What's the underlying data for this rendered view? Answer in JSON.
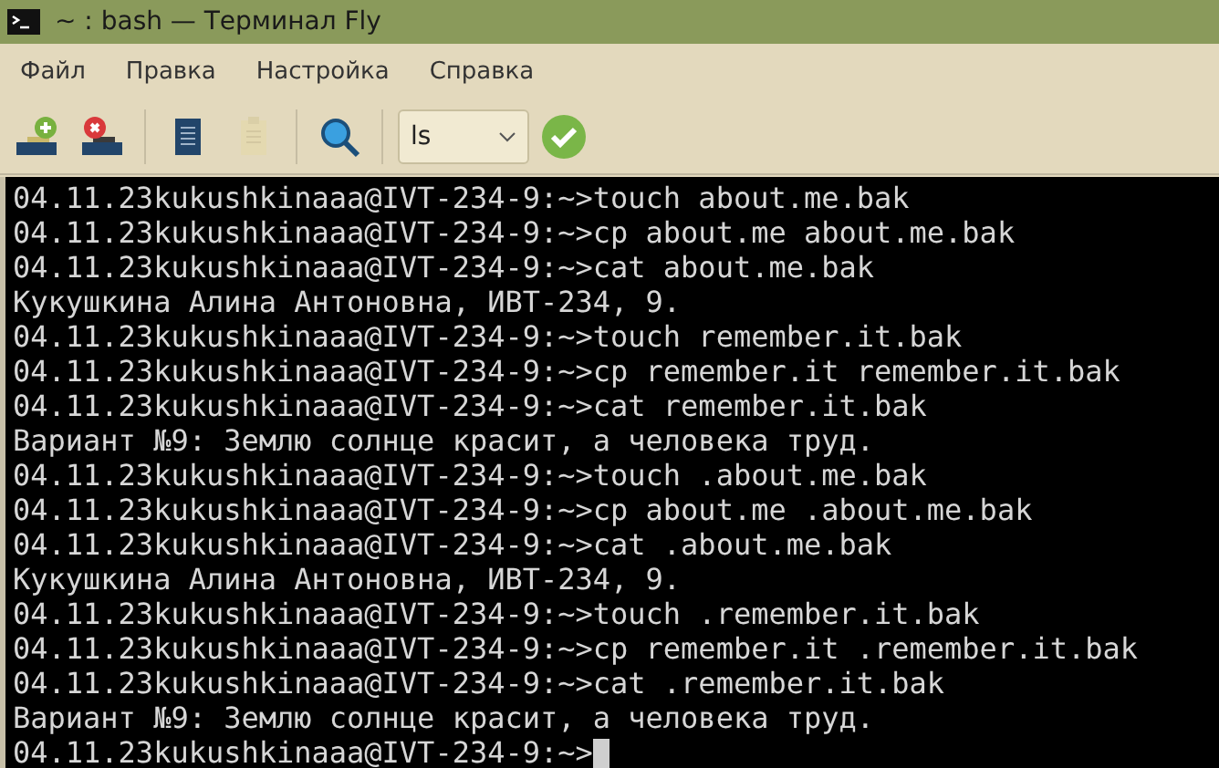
{
  "window": {
    "title": "~ : bash — Терминал Fly"
  },
  "menu": [
    "Файл",
    "Правка",
    "Настройка",
    "Справка"
  ],
  "toolbar": [
    {
      "kind": "new-tab",
      "disabled": false
    },
    {
      "kind": "close-tab",
      "disabled": false
    },
    {
      "kind": "sep"
    },
    {
      "kind": "copy",
      "disabled": false
    },
    {
      "kind": "paste",
      "disabled": true
    },
    {
      "kind": "sep"
    },
    {
      "kind": "search",
      "disabled": false
    },
    {
      "kind": "sep"
    }
  ],
  "command_combo": {
    "value": "ls"
  },
  "terminal": {
    "lines": [
      {
        "text": "04.11.23kukushkinaaa@IVT-234-9:~>touch about.me.bak",
        "cursor": false
      },
      {
        "text": "04.11.23kukushkinaaa@IVT-234-9:~>cp about.me about.me.bak",
        "cursor": false
      },
      {
        "text": "04.11.23kukushkinaaa@IVT-234-9:~>cat about.me.bak",
        "cursor": false
      },
      {
        "text": "Кукушкина Алина Антоновна, ИВТ-234, 9.",
        "cursor": false
      },
      {
        "text": "04.11.23kukushkinaaa@IVT-234-9:~>touch remember.it.bak",
        "cursor": false
      },
      {
        "text": "04.11.23kukushkinaaa@IVT-234-9:~>cp remember.it remember.it.bak",
        "cursor": false
      },
      {
        "text": "04.11.23kukushkinaaa@IVT-234-9:~>cat remember.it.bak",
        "cursor": false
      },
      {
        "text": "Вариант №9: Землю солнце красит, а человека труд.",
        "cursor": false
      },
      {
        "text": "04.11.23kukushkinaaa@IVT-234-9:~>touch .about.me.bak",
        "cursor": false
      },
      {
        "text": "04.11.23kukushkinaaa@IVT-234-9:~>cp about.me .about.me.bak",
        "cursor": false
      },
      {
        "text": "04.11.23kukushkinaaa@IVT-234-9:~>cat .about.me.bak",
        "cursor": false
      },
      {
        "text": "Кукушкина Алина Антоновна, ИВТ-234, 9.",
        "cursor": false
      },
      {
        "text": "04.11.23kukushkinaaa@IVT-234-9:~>touch .remember.it.bak",
        "cursor": false
      },
      {
        "text": "04.11.23kukushkinaaa@IVT-234-9:~>cp remember.it .remember.it.bak",
        "cursor": false
      },
      {
        "text": "04.11.23kukushkinaaa@IVT-234-9:~>cat .remember.it.bak",
        "cursor": false
      },
      {
        "text": "Вариант №9: Землю солнце красит, а человека труд.",
        "cursor": false
      },
      {
        "text": "04.11.23kukushkinaaa@IVT-234-9:~>",
        "cursor": true
      }
    ]
  }
}
